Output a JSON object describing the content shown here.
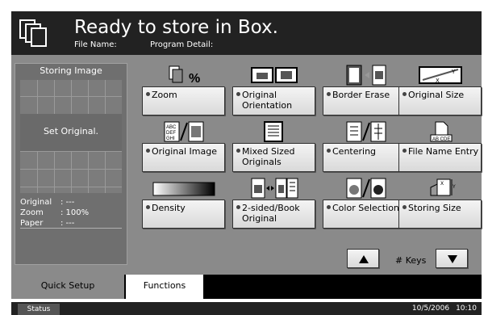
{
  "header": {
    "title": "Ready to store in Box.",
    "file_name_label": "File Name:",
    "program_detail_label": "Program Detail:"
  },
  "preview": {
    "title": "Storing Image",
    "message": "Set Original.",
    "info": [
      {
        "key": "Original",
        "value": ": ---"
      },
      {
        "key": "Zoom",
        "value": ": 100%"
      },
      {
        "key": "Paper",
        "value": ": ---"
      }
    ]
  },
  "functions": [
    {
      "label": "Zoom",
      "icon": "zoom-icon",
      "icon_text": "%"
    },
    {
      "label": "Original Orientation",
      "icon": "orientation-icon"
    },
    {
      "label": "Border Erase",
      "icon": "border-erase-icon"
    },
    {
      "label": "Original Size",
      "icon": "original-size-icon"
    },
    {
      "label": "Original Image",
      "icon": "original-image-icon",
      "icon_text": "ABC DEF GHI"
    },
    {
      "label": "Mixed Sized Originals",
      "icon": "mixed-size-icon"
    },
    {
      "label": "Centering",
      "icon": "centering-icon"
    },
    {
      "label": "File Name Entry",
      "icon": "file-name-icon",
      "icon_text": "AB CDE"
    },
    {
      "label": "Density",
      "icon": "density-icon"
    },
    {
      "label": "2-sided/Book Original",
      "icon": "duplex-icon"
    },
    {
      "label": "Color Selection",
      "icon": "color-selection-icon"
    },
    {
      "label": "Storing Size",
      "icon": "storing-size-icon"
    }
  ],
  "keys": {
    "label": "# Keys",
    "up_icon": "arrow-up-icon",
    "down_icon": "arrow-down-icon"
  },
  "tabs": [
    {
      "label": "Quick Setup",
      "active": false
    },
    {
      "label": "Functions",
      "active": true
    }
  ],
  "status": {
    "button_label": "Status",
    "date": "10/5/2006",
    "time": "10:10"
  },
  "colors": {
    "header": "#222222",
    "panel": "#8a8a8a",
    "button": "#e6e6e6"
  }
}
